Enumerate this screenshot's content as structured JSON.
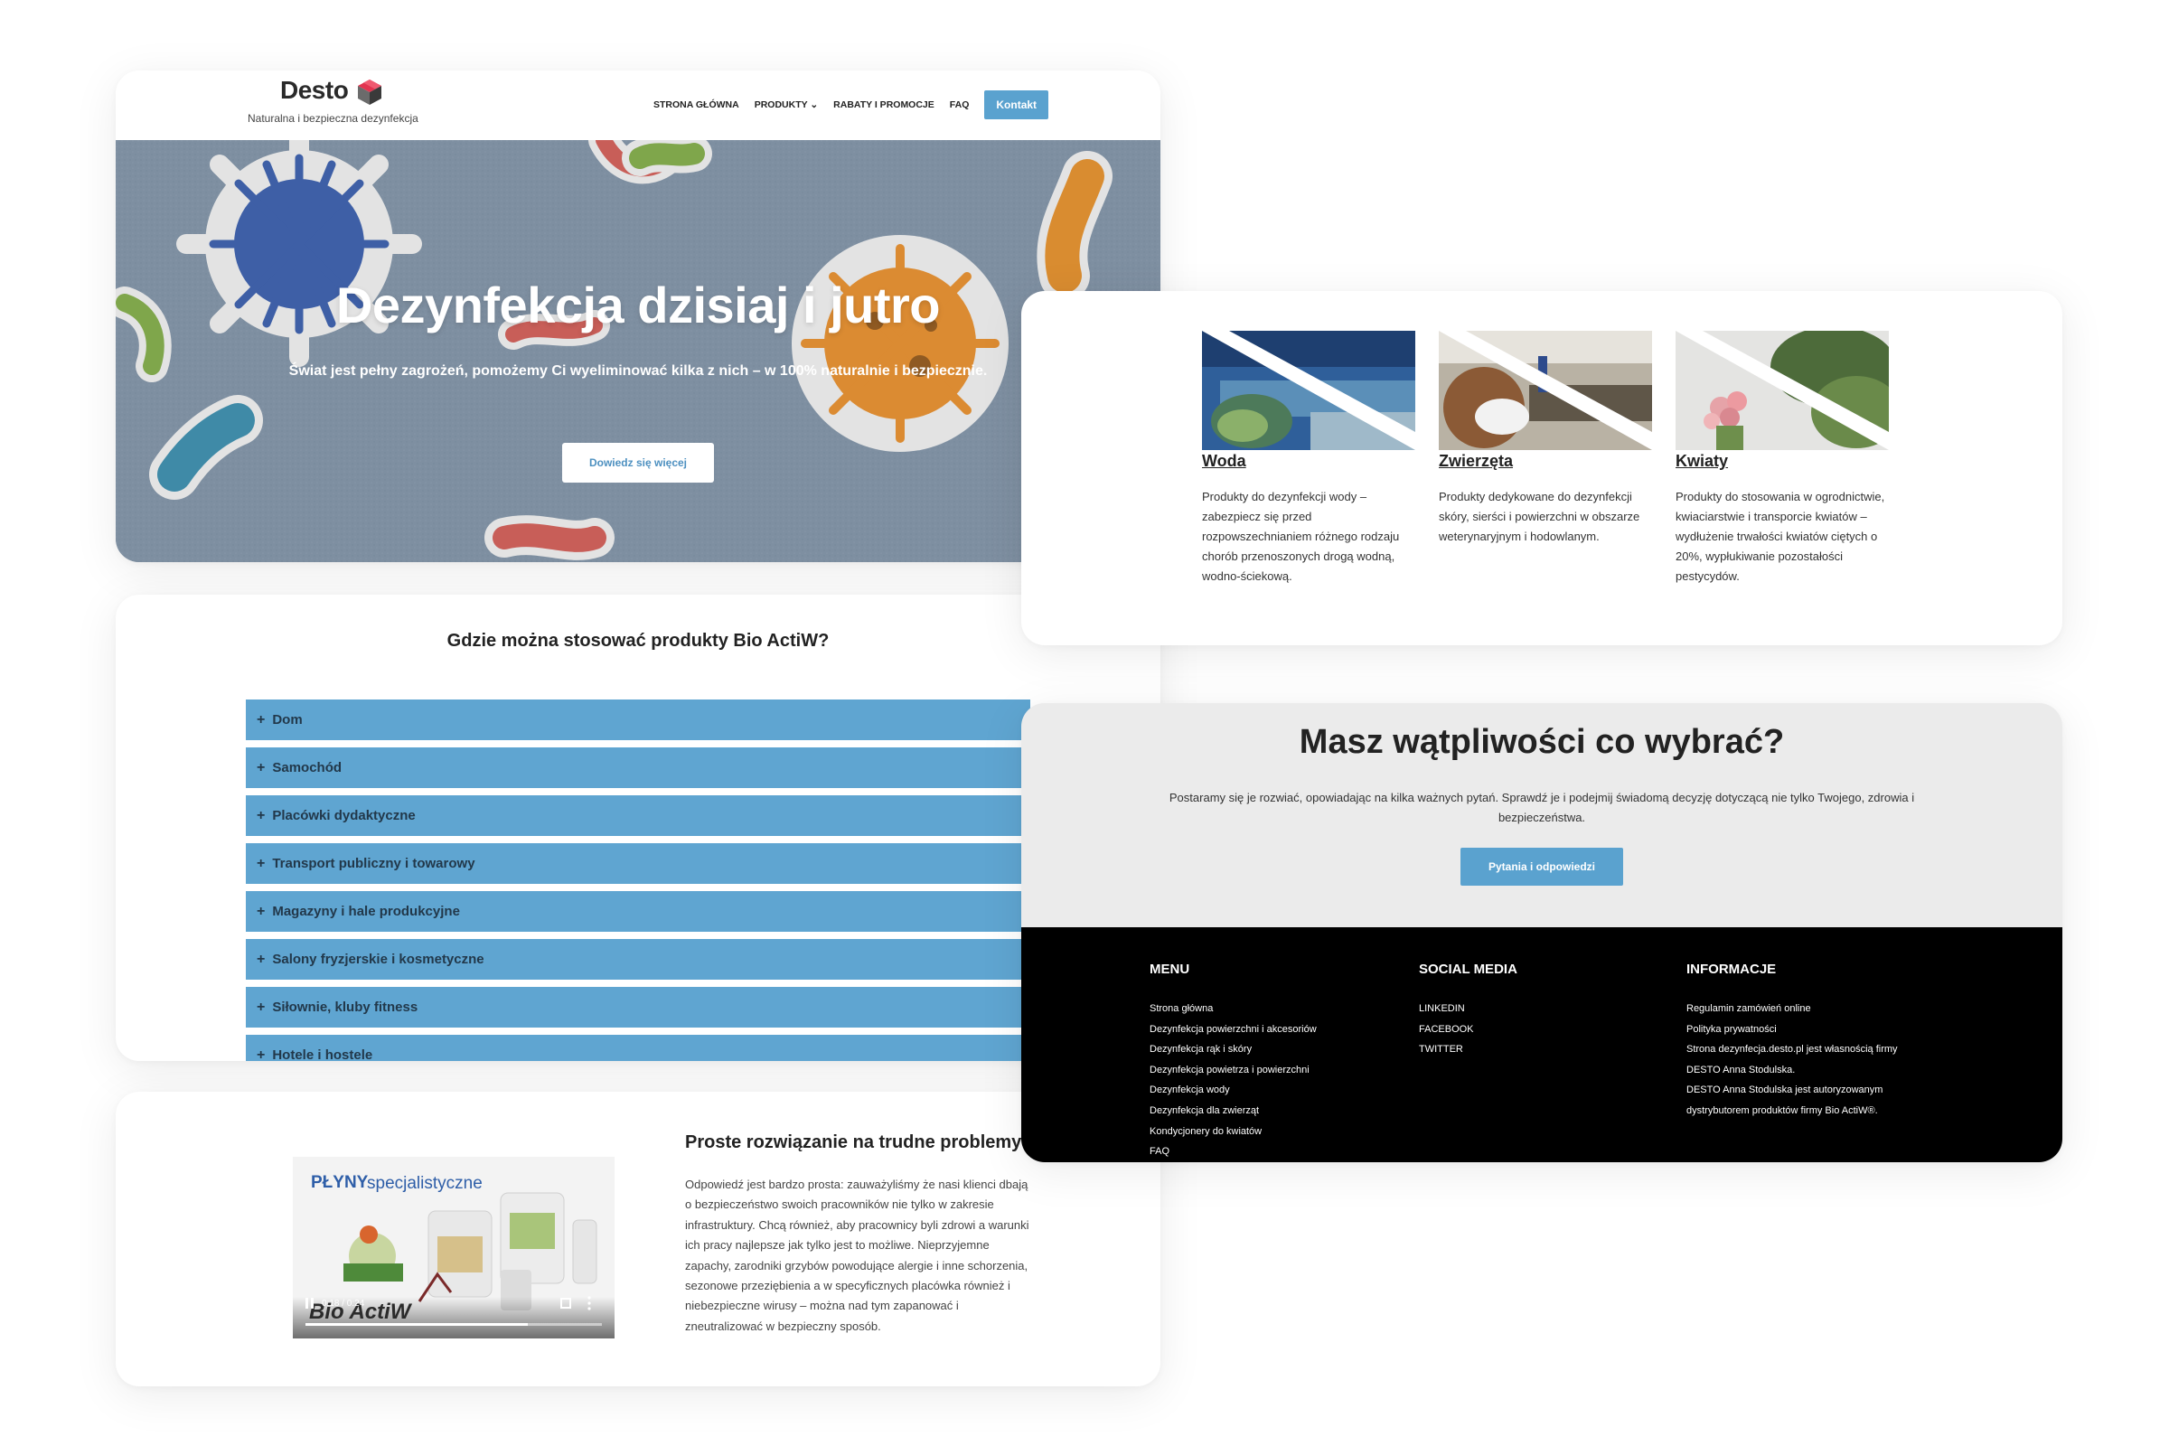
{
  "header": {
    "logo_text": "Desto",
    "tagline": "Naturalna i bezpieczna dezynfekcja",
    "nav": [
      "STRONA GŁÓWNA",
      "PRODUKTY",
      "RABATY I PROMOCJE",
      "FAQ"
    ],
    "nav_dropdown_marker": "⌄",
    "contact_label": "Kontakt"
  },
  "hero": {
    "title": "Dezynfekcja dzisiaj i jutro",
    "subtitle": "Świat jest pełny zagrożeń, pomożemy Ci wyeliminować kilka z nich – w 100% naturalnie i bezpiecznie.",
    "button_label": "Dowiedz się więcej"
  },
  "accordion": {
    "heading": "Gdzie można stosować produkty Bio ActiW?",
    "items": [
      "Dom",
      "Samochód",
      "Placówki dydaktyczne",
      "Transport publiczny i towarowy",
      "Magazyny i hale produkcyjne",
      "Salony fryzjerskie i kosmetyczne",
      "Siłownie, kluby fitness",
      "Hotele i hostele"
    ]
  },
  "video_section": {
    "video_title_bold": "PŁYNY",
    "video_title_rest": "specjalistyczne",
    "video_brand": "Bio ActiW",
    "video_time": "0:18 / 0:24",
    "video_progress": 0.75,
    "title": "Proste rozwiązanie na trudne problemy",
    "body": "Odpowiedź jest bardzo prosta: zauważyliśmy że nasi klienci dbają o bezpieczeństwo swoich pracowników nie tylko w zakresie infrastruktury. Chcą również, aby pracownicy byli zdrowi a warunki ich pracy najlepsze jak tylko jest to możliwe. Nieprzyjemne zapachy, zarodniki grzybów powodujące alergie i inne schorzenia, sezonowe przeziębienia a w specyficznych placówka również i niebezpieczne wirusy – można nad tym zapanować i zneutralizować w bezpieczny sposób."
  },
  "categories": [
    {
      "name": "Woda",
      "description": "Produkty do dezynfekcji wody – zabezpiecz się przed rozpowszechnianiem różnego rodzaju chorób przenoszonych drogą wodną, wodno-ściekową."
    },
    {
      "name": "Zwierzęta",
      "description": "Produkty dedykowane do dezynfekcji skóry, sierści i powierzchni w obszarze weterynaryjnym i hodowlanym."
    },
    {
      "name": "Kwiaty",
      "description": "Produkty do stosowania w ogrodnictwie, kwiaciarstwie i transporcie kwiatów – wydłużenie trwałości kwiatów ciętych o 20%, wypłukiwanie pozostałości pestycydów."
    }
  ],
  "cta": {
    "title": "Masz wątpliwości co wybrać?",
    "text": "Postaramy się je rozwiać, opowiadając na kilka ważnych pytań. Sprawdź je i podejmij świadomą decyzję dotyczącą nie tylko Twojego, zdrowia i bezpieczeństwa.",
    "button_label": "Pytania i odpowiedzi"
  },
  "footer": {
    "menu_heading": "MENU",
    "menu_links": [
      "Strona główna",
      "Dezynfekcja powierzchni i akcesoriów",
      "Dezynfekcja rąk i skóry",
      "Dezynfekcja powietrza i powierzchni",
      "Dezynfekcja wody",
      "Dezynfekcja dla zwierząt",
      "Kondycjonery do kwiatów",
      "FAQ"
    ],
    "social_heading": "SOCIAL MEDIA",
    "social_links": [
      "LINKEDIN",
      "FACEBOOK",
      "TWITTER"
    ],
    "info_heading": "INFORMACJE",
    "info_lines": [
      "Regulamin zamówień online",
      "Polityka prywatności",
      "Strona dezynfecja.desto.pl jest własnością firmy",
      "DESTO Anna Stodulska.",
      "DESTO Anna Stodulska jest autoryzowanym",
      "dystrybutorem produktów firmy Bio ActiW®."
    ]
  },
  "colors": {
    "accent_blue": "#5aa2cf",
    "accordion_blue": "#5fa5d1",
    "hero_background": "#7c8ea0",
    "footer_background": "#000000",
    "cta_background": "#ebebeb"
  }
}
